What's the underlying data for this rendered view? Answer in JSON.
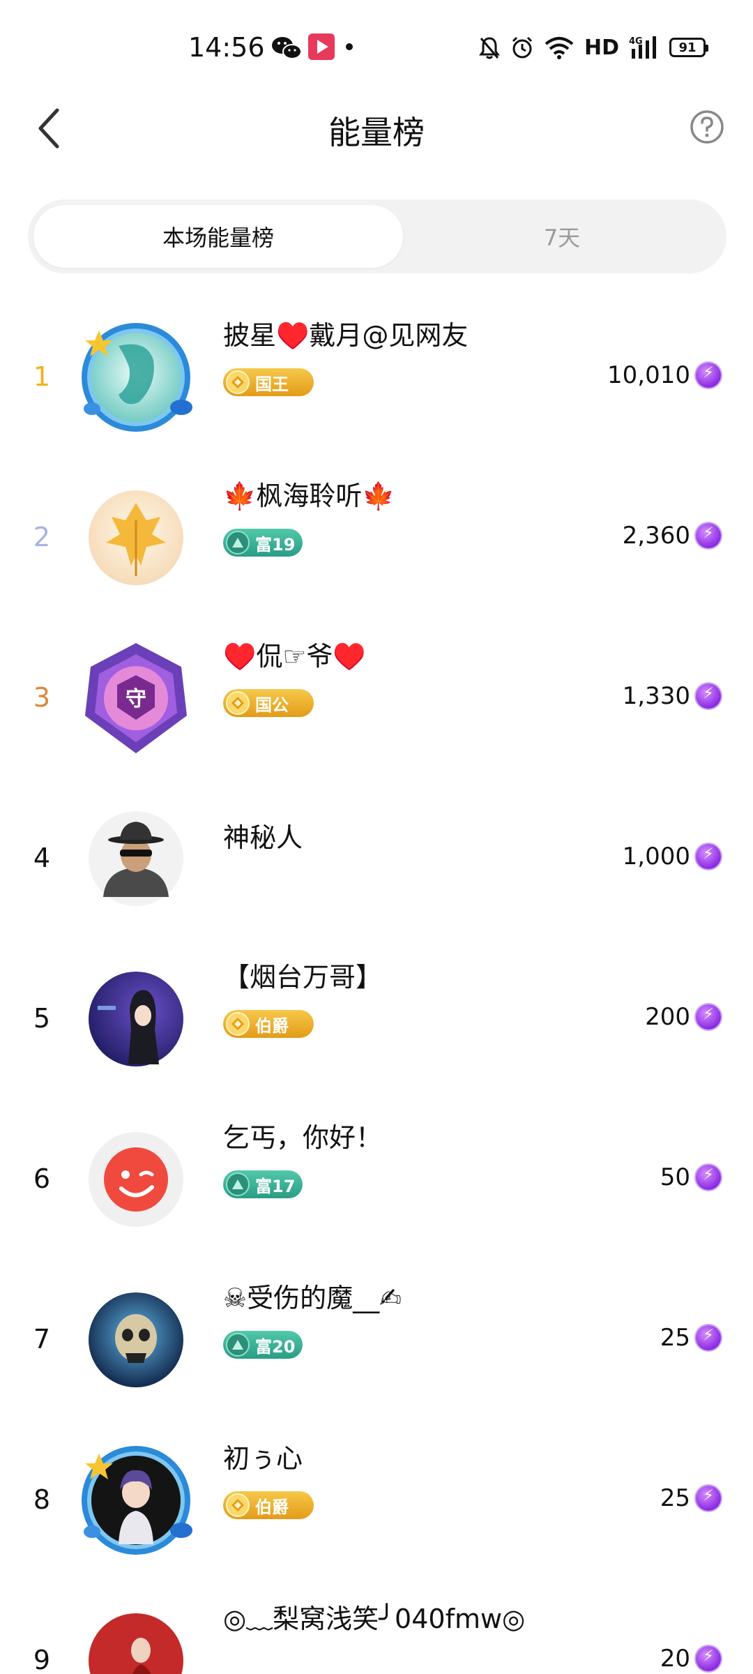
{
  "status_bar": {
    "time": "14:56",
    "network": "HD",
    "battery": "91",
    "icons": [
      "wechat-icon",
      "video-app-icon",
      "notification-dot",
      "mute-bell-icon",
      "alarm-icon",
      "wifi-icon",
      "4g-signal-icon",
      "battery-icon"
    ]
  },
  "header": {
    "title": "能量榜",
    "back_icon": "back-chevron-icon",
    "help_icon": "help-circle-icon"
  },
  "tabs": [
    {
      "label": "本场能量榜",
      "active": true
    },
    {
      "label": "7天",
      "active": false
    }
  ],
  "rank_colors": {
    "1": "#f2b01e",
    "2": "#a7b0e6",
    "3": "#d9893a",
    "default": "#111111"
  },
  "rows": [
    {
      "rank": "1",
      "name": "披星♥️戴月@见网友",
      "badge": "国王",
      "badge_type": "gold",
      "score": "10,010"
    },
    {
      "rank": "2",
      "name": "🍁枫海聆听🍁",
      "badge": "富19",
      "badge_type": "green",
      "score": "2,360"
    },
    {
      "rank": "3",
      "name": "♥️侃☞爷♥️",
      "badge": "国公",
      "badge_type": "gold",
      "score": "1,330"
    },
    {
      "rank": "4",
      "name": "神秘人",
      "badge": "",
      "badge_type": "none",
      "score": "1,000"
    },
    {
      "rank": "5",
      "name": "【烟台万哥】",
      "badge": "伯爵",
      "badge_type": "gold",
      "score": "200"
    },
    {
      "rank": "6",
      "name": "乞丐，你好！",
      "badge": "富17",
      "badge_type": "green",
      "score": "50"
    },
    {
      "rank": "7",
      "name": "☠受伤的魔__✍",
      "badge": "富20",
      "badge_type": "green",
      "score": "25"
    },
    {
      "rank": "8",
      "name": "初ぅ心",
      "badge": "伯爵",
      "badge_type": "gold",
      "score": "25"
    },
    {
      "rank": "9",
      "name": "◎﹏梨窝浅笑╯040fmw◎",
      "badge": "",
      "badge_type": "none",
      "score": "20"
    }
  ]
}
